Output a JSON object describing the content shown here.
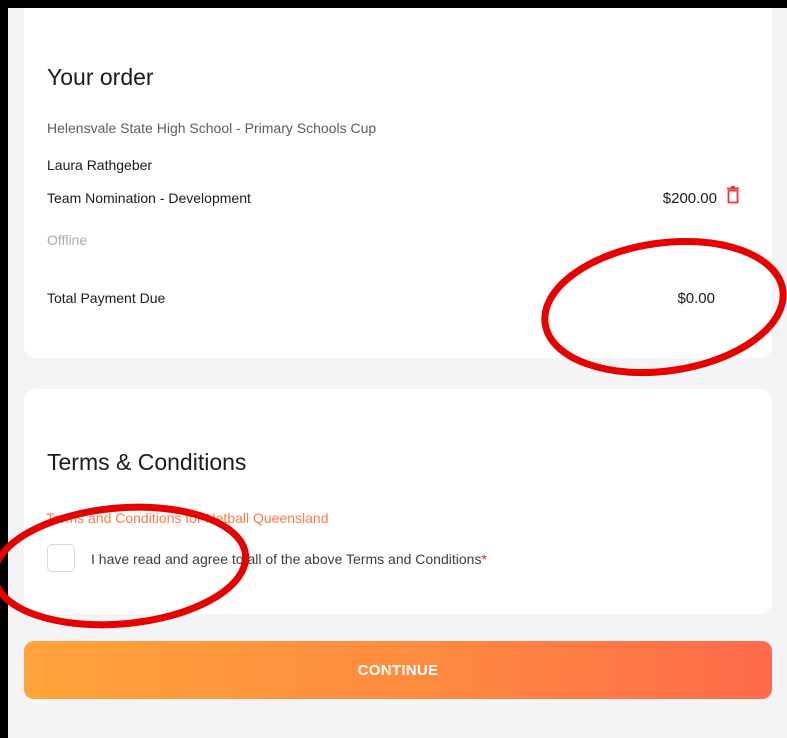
{
  "order": {
    "title": "Your order",
    "event_name": "Helensvale State High School - Primary Schools Cup",
    "participant": "Laura Rathgeber",
    "product": "Team Nomination - Development",
    "price": "$200.00",
    "payment_method": "Offline",
    "total_label": "Total Payment Due",
    "total_value": "$0.00"
  },
  "terms": {
    "title": "Terms & Conditions",
    "link_text": "Terms and Conditions for Netball Queensland",
    "agree_label": "I have read and agree to all of the above Terms and Conditions",
    "required_marker": "*",
    "checked": false
  },
  "actions": {
    "continue_label": "CONTINUE"
  },
  "icons": {
    "delete": "trash-icon"
  },
  "colors": {
    "accent": "#ff7a4a",
    "delete_icon": "#f0343a",
    "annotation": "#e60000",
    "button_start": "#ffa43a",
    "button_end": "#ff6a4a"
  }
}
